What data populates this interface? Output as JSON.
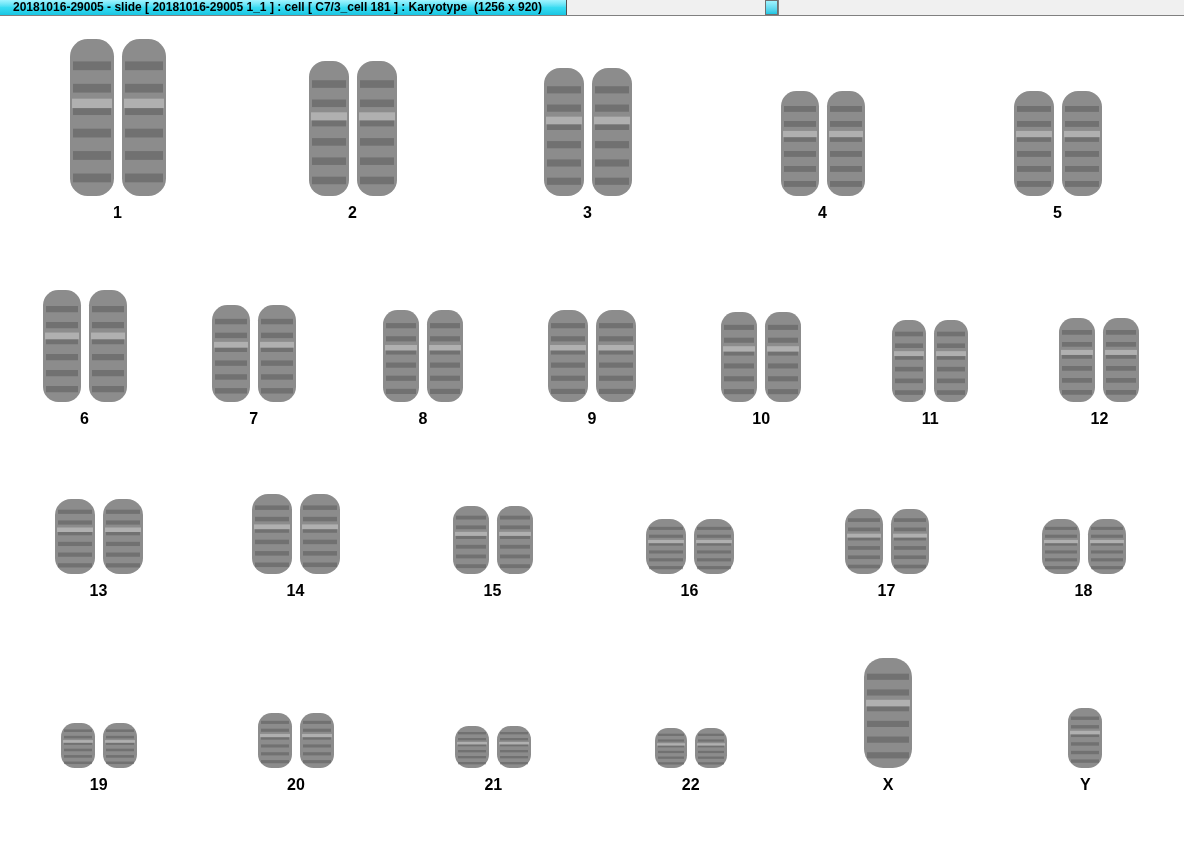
{
  "window": {
    "title": "20181016-29005 - slide [ 20181016-29005 1_1 ] : cell [ C7/3_cell 181 ] : Karyotype  (1256 x 920)"
  },
  "karyotype": {
    "rows": [
      [
        {
          "label": "1",
          "kind": "pair"
        },
        {
          "label": "2",
          "kind": "pair"
        },
        {
          "label": "3",
          "kind": "pair"
        },
        {
          "label": "4",
          "kind": "pair"
        },
        {
          "label": "5",
          "kind": "pair"
        }
      ],
      [
        {
          "label": "6",
          "kind": "pair"
        },
        {
          "label": "7",
          "kind": "pair"
        },
        {
          "label": "8",
          "kind": "pair"
        },
        {
          "label": "9",
          "kind": "pair"
        },
        {
          "label": "10",
          "kind": "pair"
        },
        {
          "label": "11",
          "kind": "pair"
        },
        {
          "label": "12",
          "kind": "pair"
        }
      ],
      [
        {
          "label": "13",
          "kind": "pair"
        },
        {
          "label": "14",
          "kind": "pair"
        },
        {
          "label": "15",
          "kind": "pair"
        },
        {
          "label": "16",
          "kind": "pair"
        },
        {
          "label": "17",
          "kind": "pair"
        },
        {
          "label": "18",
          "kind": "pair"
        }
      ],
      [
        {
          "label": "19",
          "kind": "pair"
        },
        {
          "label": "20",
          "kind": "pair"
        },
        {
          "label": "21",
          "kind": "pair"
        },
        {
          "label": "22",
          "kind": "pair"
        },
        {
          "label": "X",
          "kind": "single"
        },
        {
          "label": "Y",
          "kind": "single"
        }
      ]
    ]
  }
}
